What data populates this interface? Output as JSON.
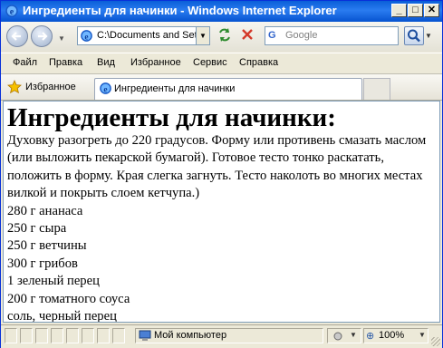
{
  "window": {
    "title": "Ингредиенты для начинки - Windows Internet Explorer",
    "controls": {
      "minimize": "_",
      "maximize": "□",
      "close": "✕"
    }
  },
  "navbar": {
    "address": "C:\\Documents and Settings\\",
    "search_placeholder": "Google"
  },
  "menu": [
    "Файл",
    "Правка",
    "Вид",
    "Избранное",
    "Сервис",
    "Справка"
  ],
  "favorites": {
    "label": "Избранное",
    "tab_title": "Ингредиенты для начинки"
  },
  "page": {
    "heading": "Ингредиенты для начинки:",
    "instructions": "Духовку разогреть до 220 градусов. Форму или противень смазать маслом (или выложить пекарской бумагой). Готовое тесто тонко раскатать, положить в форму. Края слегка загнуть. Тесто наколоть во многих местах вилкой и покрыть слоем кетчупа.)",
    "ingredients": [
      "280 г ананаса",
      "250 г сыра",
      "250 г ветчины",
      "300 г грибов",
      "1 зеленый перец",
      "200 г томатного соуса",
      "соль, черный перец"
    ]
  },
  "status": {
    "zone": "Мой компьютер",
    "zoom": "100%"
  },
  "icons": {
    "back": "back-arrow-icon",
    "forward": "forward-arrow-icon",
    "refresh": "refresh-icon",
    "stop": "stop-icon",
    "search": "magnifier-icon",
    "favorites": "star-icon",
    "page": "ie-logo-icon",
    "zone": "computer-icon"
  },
  "colors": {
    "titlebar": "#0a5fd8",
    "chrome": "#ece9d8",
    "content_bg": "#ffffff"
  }
}
